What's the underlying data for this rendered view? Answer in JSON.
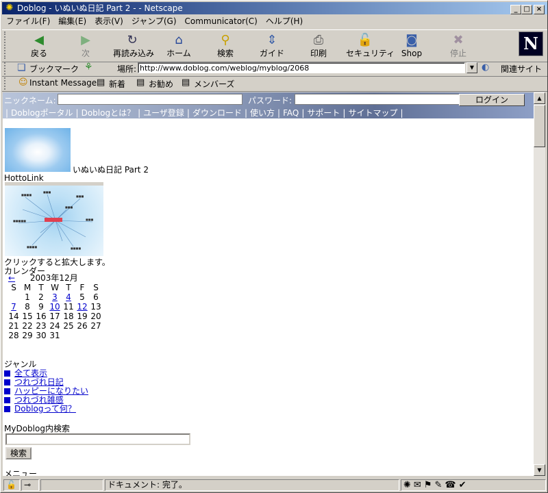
{
  "window": {
    "title": "Doblog - いぬいぬ日記 Part 2 - - Netscape",
    "controls": [
      "_",
      "□",
      "×"
    ]
  },
  "menu": [
    "ファイル(F)",
    "編集(E)",
    "表示(V)",
    "ジャンプ(G)",
    "Communicator(C)",
    "ヘルプ(H)"
  ],
  "toolbar": {
    "buttons": [
      {
        "label": "戻る",
        "icon": "back-arrow-icon"
      },
      {
        "label": "次",
        "icon": "forward-arrow-icon"
      },
      {
        "label": "再読み込み",
        "icon": "reload-icon"
      },
      {
        "label": "ホーム",
        "icon": "home-icon"
      },
      {
        "label": "検索",
        "icon": "search-icon"
      },
      {
        "label": "ガイド",
        "icon": "guide-icon"
      },
      {
        "label": "印刷",
        "icon": "print-icon"
      },
      {
        "label": "セキュリティ",
        "icon": "security-lock-icon"
      },
      {
        "label": "Shop",
        "icon": "shop-icon"
      },
      {
        "label": "停止",
        "icon": "stop-icon"
      }
    ],
    "logo": "N"
  },
  "location": {
    "bookmark_label": "ブックマーク",
    "label": "場所:",
    "url": "http://www.doblog.com/weblog/myblog/2068",
    "related_label": "関連サイト"
  },
  "personal_bar": [
    "Instant Message",
    "新着",
    "お勧め",
    "メンバーズ"
  ],
  "page": {
    "nickname_label": "ニックネーム:",
    "password_label": "パスワード:",
    "login_button": "ログイン",
    "nav": [
      "Doblogポータル",
      "Doblogとは？",
      "ユーザ登録",
      "ダウンロード",
      "使い方",
      "FAQ",
      "サポート",
      "サイトマップ"
    ],
    "blog_title": "いぬいぬ日記 Part 2",
    "hottolink_label": "HottoLink",
    "click_caption": "クリックすると拡大します。",
    "calendar": {
      "heading": "カレンダー",
      "prev": "←",
      "month": "2003年12月",
      "weekdays": [
        "S",
        "M",
        "T",
        "W",
        "T",
        "F",
        "S"
      ],
      "weeks": [
        [
          "",
          "1",
          "2",
          "3",
          "4",
          "5",
          "6"
        ],
        [
          "7",
          "8",
          "9",
          "10",
          "11",
          "12",
          "13"
        ],
        [
          "14",
          "15",
          "16",
          "17",
          "18",
          "19",
          "20"
        ],
        [
          "21",
          "22",
          "23",
          "24",
          "25",
          "26",
          "27"
        ],
        [
          "28",
          "29",
          "30",
          "31",
          "",
          "",
          ""
        ]
      ],
      "linked_days": [
        "3",
        "4",
        "7",
        "10",
        "12"
      ]
    },
    "genre": {
      "heading": "ジャンル",
      "items": [
        "全て表示",
        "つれづれ日記",
        "ハッピーになりたい",
        "つれづれ雑感",
        "Doblogって何？"
      ]
    },
    "search": {
      "heading": "MyDoblog内検索",
      "button": "検索"
    },
    "menu_heading": "メニュー"
  },
  "status": {
    "text": "ドキュメント: 完了。"
  }
}
